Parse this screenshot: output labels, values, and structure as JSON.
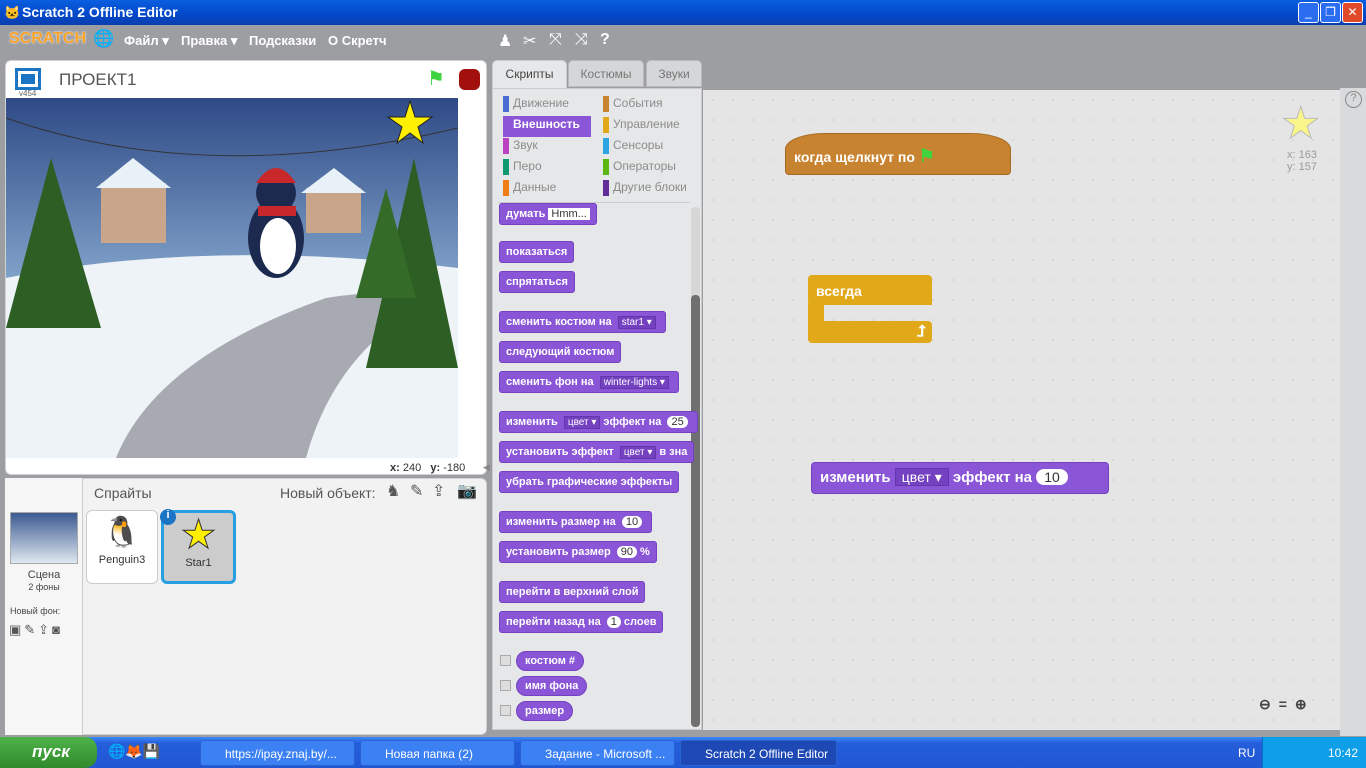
{
  "window": {
    "title": "Scratch 2 Offline Editor"
  },
  "menu": {
    "logo": "SCRATCH",
    "items": [
      "Файл ▾",
      "Правка ▾",
      "Подсказки",
      "О Скретч"
    ],
    "tools": [
      "stamp-icon",
      "cut-icon",
      "grow-icon",
      "shrink-icon",
      "help-icon"
    ]
  },
  "stage": {
    "project_title": "ПРОЕКТ1",
    "version": "v454",
    "x_label": "x:",
    "x": "240",
    "y_label": "y:",
    "y": "-180"
  },
  "sprites": {
    "header": "Спрайты",
    "new_label": "Новый объект:",
    "scene_label": "Сцена",
    "scene_sub": "2 фоны",
    "new_backdrop": "Новый фон:",
    "items": [
      {
        "name": "Penguin3"
      },
      {
        "name": "Star1",
        "selected": true
      }
    ]
  },
  "tabs": [
    "Скрипты",
    "Костюмы",
    "Звуки"
  ],
  "categories": [
    {
      "label": "Движение",
      "color": "#4a6cd4"
    },
    {
      "label": "События",
      "color": "#c88330"
    },
    {
      "label": "Внешность",
      "color": "#8a55d7",
      "selected": true
    },
    {
      "label": "Управление",
      "color": "#e1a91a"
    },
    {
      "label": "Звук",
      "color": "#bb42c3"
    },
    {
      "label": "Сенсоры",
      "color": "#2ca5e2"
    },
    {
      "label": "Перо",
      "color": "#0e9a6c"
    },
    {
      "label": "Операторы",
      "color": "#5cb712"
    },
    {
      "label": "Данные",
      "color": "#ee7d16"
    },
    {
      "label": "Другие блоки",
      "color": "#632d99"
    }
  ],
  "palette": [
    {
      "parts": [
        [
          "t",
          "думать"
        ],
        [
          "s",
          "Hmm..."
        ]
      ]
    },
    {
      "parts": [
        [
          "t",
          "показаться"
        ]
      ]
    },
    {
      "parts": [
        [
          "t",
          "спрятаться"
        ]
      ]
    },
    {
      "parts": [
        [
          "t",
          "сменить костюм на"
        ],
        [
          "d",
          "star1 ▾"
        ]
      ]
    },
    {
      "parts": [
        [
          "t",
          "следующий костюм"
        ]
      ]
    },
    {
      "parts": [
        [
          "t",
          "сменить фон на"
        ],
        [
          "d",
          "winter-lights ▾"
        ]
      ]
    },
    {
      "parts": [
        [
          "t",
          "изменить"
        ],
        [
          "d",
          "цвет ▾"
        ],
        [
          "t",
          "эффект на"
        ],
        [
          "n",
          "25"
        ]
      ]
    },
    {
      "parts": [
        [
          "t",
          "установить эффект"
        ],
        [
          "d",
          "цвет ▾"
        ],
        [
          "t",
          "в зна"
        ]
      ]
    },
    {
      "parts": [
        [
          "t",
          "убрать графические эффекты"
        ]
      ]
    },
    {
      "parts": [
        [
          "t",
          "изменить размер на"
        ],
        [
          "n",
          "10"
        ]
      ]
    },
    {
      "parts": [
        [
          "t",
          "установить размер"
        ],
        [
          "n",
          "90"
        ],
        [
          "t",
          "%"
        ]
      ]
    },
    {
      "parts": [
        [
          "t",
          "перейти в верхний слой"
        ]
      ]
    },
    {
      "parts": [
        [
          "t",
          "перейти назад на"
        ],
        [
          "n",
          "1"
        ],
        [
          "t",
          "слоев"
        ]
      ]
    }
  ],
  "reporters": [
    {
      "label": "костюм #"
    },
    {
      "label": "имя фона"
    },
    {
      "label": "размер"
    }
  ],
  "scripts": {
    "hat": "когда щелкнут по",
    "forever": "всегда",
    "change_a": "изменить",
    "change_dd": "цвет",
    "change_b": "эффект на",
    "change_val": "10",
    "sprite_x": "x: 163",
    "sprite_y": "y: 157"
  },
  "taskbar": {
    "start": "пуск",
    "tasks": [
      "https://ipay.znaj.by/...",
      "Новая папка (2)",
      "Задание - Microsoft ...",
      "Scratch 2 Offline Editor"
    ],
    "lang": "RU",
    "clock": "10:42"
  }
}
